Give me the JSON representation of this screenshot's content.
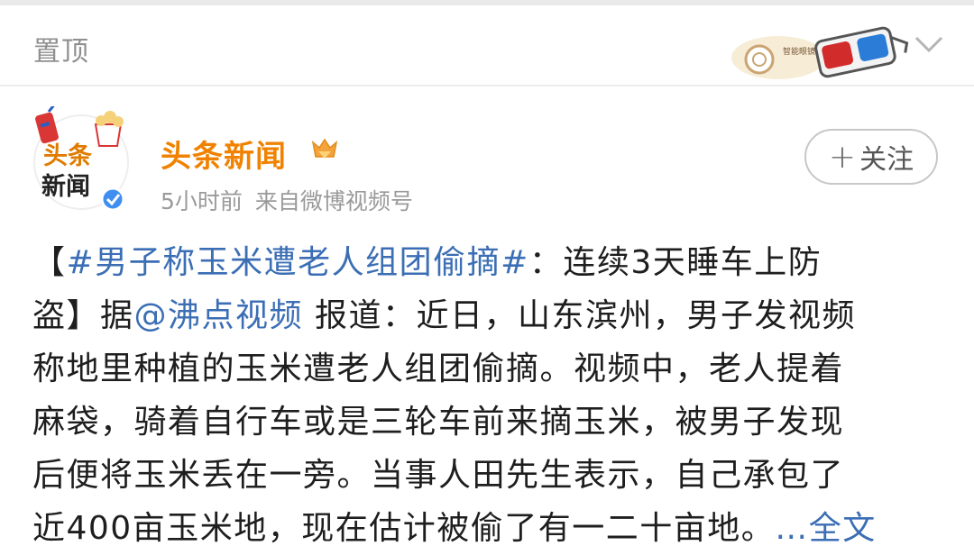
{
  "pinned": {
    "label": "置顶"
  },
  "sticker": {
    "text": "智能眼镜之家"
  },
  "avatar": {
    "line1": "头条",
    "line2": "新闻"
  },
  "author": {
    "name": "头条新闻"
  },
  "meta": {
    "time": "5小时前",
    "source": "来自微博视频号"
  },
  "follow": {
    "plus": "+",
    "label": "关注"
  },
  "post": {
    "lines": [
      [
        {
          "t": "【",
          "k": "text"
        },
        {
          "t": "#男子称玉米遭老人组团偷摘#",
          "k": "link"
        },
        {
          "t": "：连续3天睡车上防",
          "k": "text"
        }
      ],
      [
        {
          "t": "盗】据",
          "k": "text"
        },
        {
          "t": "@沸点视频",
          "k": "link"
        },
        {
          "t": " 报道：近日，山东滨州，男子发视频",
          "k": "text"
        }
      ],
      [
        {
          "t": "称地里种植的玉米遭老人组团偷摘。视频中，老人提着",
          "k": "text"
        }
      ],
      [
        {
          "t": "麻袋，骑着自行车或是三轮车前来摘玉米，被男子发现",
          "k": "text"
        }
      ],
      [
        {
          "t": "后便将玉米丢在一旁。当事人田先生表示，自己承包了",
          "k": "text"
        }
      ],
      [
        {
          "t": "近400亩玉米地，现在估计被偷了有一二十亩地。",
          "k": "text"
        },
        {
          "t": "…全文",
          "k": "more"
        }
      ]
    ]
  },
  "colors": {
    "accent": "#f08200",
    "link": "#3b6eb4",
    "text": "#1e1e1e",
    "muted": "#9a9a9a"
  }
}
